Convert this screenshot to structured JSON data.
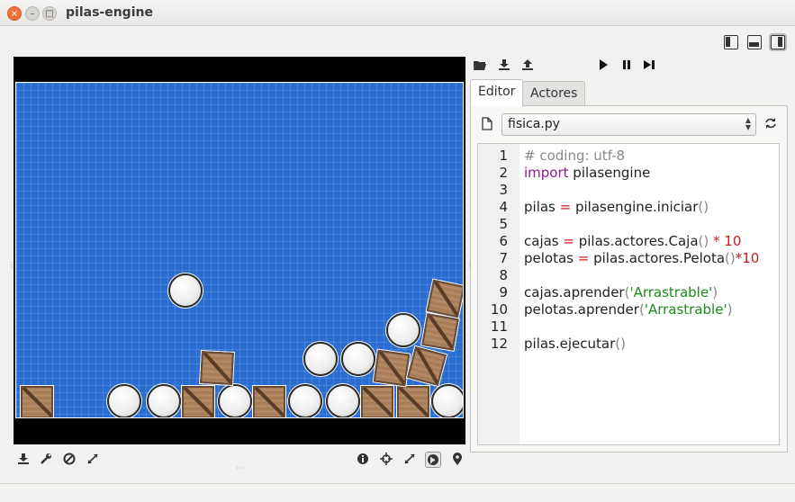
{
  "window": {
    "title": "pilas-engine",
    "close_glyph": "×",
    "min_glyph": "–",
    "max_glyph": "□"
  },
  "toolbar": {
    "open_icon": "folder-open-icon",
    "save_icon": "download-icon",
    "export_icon": "export-icon",
    "play_icon": "play-icon",
    "pause_icon": "pause-icon",
    "step_icon": "step-forward-icon"
  },
  "tabs": [
    {
      "label": "Editor"
    },
    {
      "label": "Actores"
    }
  ],
  "file_selector": {
    "value": "fisica.py"
  },
  "code_lines": [
    {
      "n": "1",
      "html_parts": [
        {
          "t": "# coding: utf-8",
          "c": "cm"
        }
      ]
    },
    {
      "n": "2",
      "html_parts": [
        {
          "t": "import",
          "c": "kw"
        },
        {
          "t": " pilasengine",
          "c": ""
        }
      ]
    },
    {
      "n": "3",
      "html_parts": []
    },
    {
      "n": "4",
      "html_parts": [
        {
          "t": "pilas ",
          "c": ""
        },
        {
          "t": "=",
          "c": "op"
        },
        {
          "t": " pilasengine.iniciar",
          "c": ""
        },
        {
          "t": "()",
          "c": "par"
        }
      ]
    },
    {
      "n": "5",
      "html_parts": []
    },
    {
      "n": "6",
      "html_parts": [
        {
          "t": "cajas ",
          "c": ""
        },
        {
          "t": "=",
          "c": "op"
        },
        {
          "t": " pilas.actores.Caja",
          "c": ""
        },
        {
          "t": "()",
          "c": "par"
        },
        {
          "t": " * 10",
          "c": "num"
        }
      ]
    },
    {
      "n": "7",
      "html_parts": [
        {
          "t": "pelotas ",
          "c": ""
        },
        {
          "t": "=",
          "c": "op"
        },
        {
          "t": " pilas.actores.Pelota",
          "c": ""
        },
        {
          "t": "()",
          "c": "par"
        },
        {
          "t": "*10",
          "c": "num"
        }
      ]
    },
    {
      "n": "8",
      "html_parts": []
    },
    {
      "n": "9",
      "html_parts": [
        {
          "t": "cajas.aprender",
          "c": ""
        },
        {
          "t": "(",
          "c": "par"
        },
        {
          "t": "'Arrastrable'",
          "c": "str"
        },
        {
          "t": ")",
          "c": "par"
        }
      ]
    },
    {
      "n": "10",
      "html_parts": [
        {
          "t": "pelotas.aprender",
          "c": ""
        },
        {
          "t": "(",
          "c": "par"
        },
        {
          "t": "'Arrastrable'",
          "c": "str"
        },
        {
          "t": ")",
          "c": "par"
        }
      ]
    },
    {
      "n": "11",
      "html_parts": []
    },
    {
      "n": "12",
      "html_parts": [
        {
          "t": "pilas.ejecutar",
          "c": ""
        },
        {
          "t": "()",
          "c": "par"
        }
      ]
    }
  ],
  "colors": {
    "scene_bg": "#2a6dd0",
    "keyword": "#8c1a8c",
    "string": "#1a8c1a",
    "operator": "#c81e1e",
    "comment": "#888888"
  },
  "bottom_toolbar": {
    "left_icons": [
      "download-icon",
      "wrench-icon",
      "disable-icon",
      "expand-icon"
    ],
    "right_icons": [
      "info-icon",
      "crosshair-icon",
      "expand-icon",
      "globe-icon",
      "pin-icon"
    ]
  }
}
